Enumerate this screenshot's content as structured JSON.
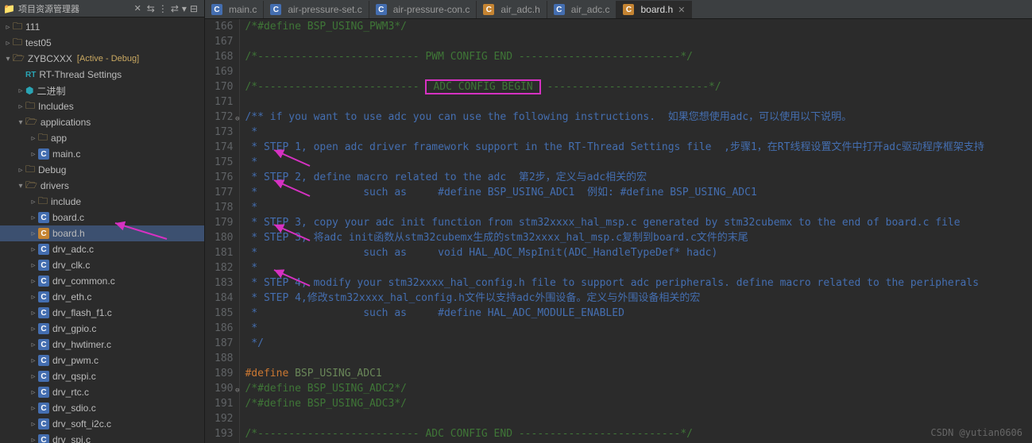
{
  "sidebar": {
    "title": "项目资源管理器",
    "tools": [
      "⇆",
      "⋮",
      "⇄",
      "▾",
      "⊟"
    ],
    "tree": [
      {
        "depth": 0,
        "tw": "▹",
        "icon": "folder",
        "label": "111"
      },
      {
        "depth": 0,
        "tw": "▹",
        "icon": "folder",
        "label": "test05"
      },
      {
        "depth": 0,
        "tw": "▾",
        "icon": "folder-open",
        "label": "ZYBCXXX",
        "extra": "[Active - Debug]"
      },
      {
        "depth": 1,
        "tw": "",
        "icon": "rt",
        "label": "RT-Thread Settings"
      },
      {
        "depth": 1,
        "tw": "▹",
        "icon": "bin",
        "label": "二进制"
      },
      {
        "depth": 1,
        "tw": "▹",
        "icon": "folder",
        "label": "Includes"
      },
      {
        "depth": 1,
        "tw": "▾",
        "icon": "folder-open",
        "label": "applications"
      },
      {
        "depth": 2,
        "tw": "▹",
        "icon": "folder",
        "label": "app"
      },
      {
        "depth": 2,
        "tw": "▹",
        "icon": "c",
        "label": "main.c"
      },
      {
        "depth": 1,
        "tw": "▹",
        "icon": "folder",
        "label": "Debug"
      },
      {
        "depth": 1,
        "tw": "▾",
        "icon": "folder-open",
        "label": "drivers"
      },
      {
        "depth": 2,
        "tw": "▹",
        "icon": "folder",
        "label": "include"
      },
      {
        "depth": 2,
        "tw": "▹",
        "icon": "c",
        "label": "board.c"
      },
      {
        "depth": 2,
        "tw": "▹",
        "icon": "c-orange",
        "label": "board.h",
        "selected": true
      },
      {
        "depth": 2,
        "tw": "▹",
        "icon": "c",
        "label": "drv_adc.c"
      },
      {
        "depth": 2,
        "tw": "▹",
        "icon": "c",
        "label": "drv_clk.c"
      },
      {
        "depth": 2,
        "tw": "▹",
        "icon": "c",
        "label": "drv_common.c"
      },
      {
        "depth": 2,
        "tw": "▹",
        "icon": "c",
        "label": "drv_eth.c"
      },
      {
        "depth": 2,
        "tw": "▹",
        "icon": "c",
        "label": "drv_flash_f1.c"
      },
      {
        "depth": 2,
        "tw": "▹",
        "icon": "c",
        "label": "drv_gpio.c"
      },
      {
        "depth": 2,
        "tw": "▹",
        "icon": "c",
        "label": "drv_hwtimer.c"
      },
      {
        "depth": 2,
        "tw": "▹",
        "icon": "c",
        "label": "drv_pwm.c"
      },
      {
        "depth": 2,
        "tw": "▹",
        "icon": "c",
        "label": "drv_qspi.c"
      },
      {
        "depth": 2,
        "tw": "▹",
        "icon": "c",
        "label": "drv_rtc.c"
      },
      {
        "depth": 2,
        "tw": "▹",
        "icon": "c",
        "label": "drv_sdio.c"
      },
      {
        "depth": 2,
        "tw": "▹",
        "icon": "c",
        "label": "drv_soft_i2c.c"
      },
      {
        "depth": 2,
        "tw": "▹",
        "icon": "c",
        "label": "drv_spi.c"
      }
    ]
  },
  "tabs": [
    {
      "icon": "c",
      "label": "main.c"
    },
    {
      "icon": "c",
      "label": "air-pressure-set.c"
    },
    {
      "icon": "c",
      "label": "air-pressure-con.c"
    },
    {
      "icon": "c-orange",
      "label": "air_adc.h"
    },
    {
      "icon": "c",
      "label": "air_adc.c"
    },
    {
      "icon": "c-orange",
      "label": "board.h",
      "active": true
    }
  ],
  "code": {
    "start": 166,
    "lines": [
      {
        "cls": "cm",
        "t": "/*#define BSP_USING_PWM3*/"
      },
      {
        "cls": "",
        "t": ""
      },
      {
        "cls": "cm",
        "t": "/*-------------------------- PWM CONFIG END --------------------------*/"
      },
      {
        "cls": "",
        "t": ""
      },
      {
        "cls": "cm",
        "t": "/*-------------------------- ",
        "box": "ADC CONFIG BEGIN",
        "after": " --------------------------*/"
      },
      {
        "cls": "",
        "t": ""
      },
      {
        "cls": "cm2",
        "t": "/** if you want to use adc you can use the following instructions.  如果您想使用adc，可以使用以下说明。",
        "marker": true
      },
      {
        "cls": "cm2",
        "t": " *"
      },
      {
        "cls": "cm2",
        "t": " * STEP 1, open adc driver framework support in the RT-Thread Settings file  ,步骤1，在RT线程设置文件中打开adc驱动程序框架支持"
      },
      {
        "cls": "cm2",
        "t": " *"
      },
      {
        "cls": "cm2",
        "t": " * STEP 2, define macro related to the adc  第2步，定义与adc相关的宏"
      },
      {
        "cls": "cm2",
        "t": " *                 such as     #define BSP_USING_ADC1  例如: #define BSP_USING_ADC1"
      },
      {
        "cls": "cm2",
        "t": " *"
      },
      {
        "cls": "cm2",
        "t": " * STEP 3, copy your adc init function from stm32xxxx_hal_msp.c generated by stm32cubemx to the end of board.c file"
      },
      {
        "cls": "cm2",
        "t": " * STEP 3, 将adc init函数从stm32cubemx生成的stm32xxxx_hal_msp.c复制到board.c文件的末尾"
      },
      {
        "cls": "cm2",
        "t": " *                 such as     void HAL_ADC_MspInit(ADC_HandleTypeDef* hadc)"
      },
      {
        "cls": "cm2",
        "t": " *"
      },
      {
        "cls": "cm2",
        "t": " * STEP 4, modify your stm32xxxx_hal_config.h file to support adc peripherals. define macro related to the peripherals"
      },
      {
        "cls": "cm2",
        "t": " * STEP 4,修改stm32xxxx_hal_config.h文件以支持adc外围设备。定义与外围设备相关的宏"
      },
      {
        "cls": "cm2",
        "t": " *                 such as     #define HAL_ADC_MODULE_ENABLED"
      },
      {
        "cls": "cm2",
        "t": " *"
      },
      {
        "cls": "cm2",
        "t": " */"
      },
      {
        "cls": "",
        "t": ""
      },
      {
        "cls": "def",
        "t": "#define BSP_USING_ADC1"
      },
      {
        "cls": "cm",
        "t": "/*#define BSP_USING_ADC2*/",
        "marker": true
      },
      {
        "cls": "cm",
        "t": "/*#define BSP_USING_ADC3*/"
      },
      {
        "cls": "",
        "t": ""
      },
      {
        "cls": "cm",
        "t": "/*-------------------------- ADC CONFIG END --------------------------*/"
      }
    ]
  },
  "watermark": "CSDN @yutian0606"
}
